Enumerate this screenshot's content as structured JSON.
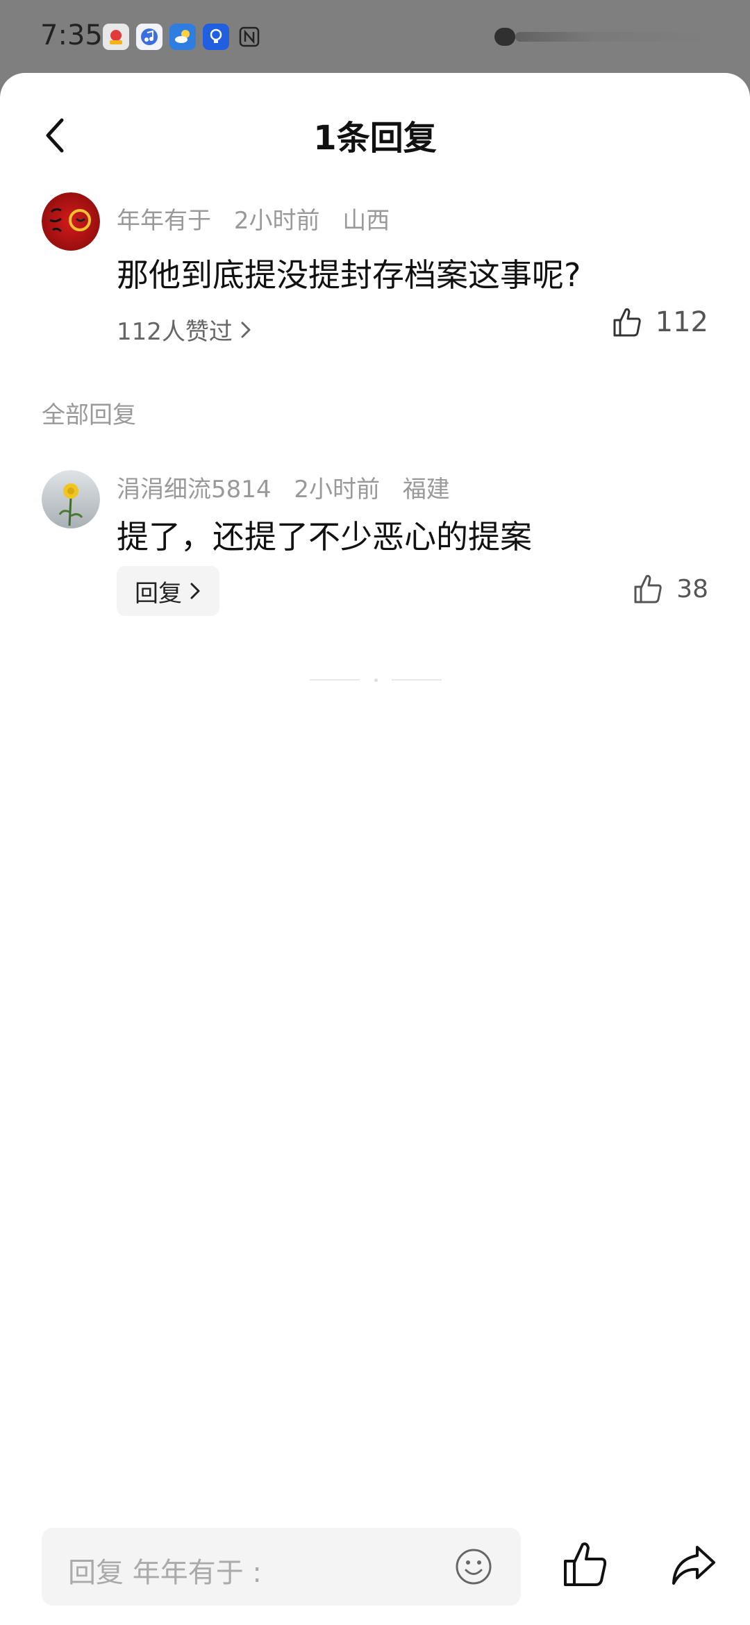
{
  "status_bar": {
    "time": "7:35",
    "icons": [
      "app-notification-icon",
      "music-icon",
      "weather-icon",
      "lightbulb-icon",
      "nfc-icon"
    ]
  },
  "header": {
    "title": "1条回复",
    "back_icon": "chevron-left-icon"
  },
  "main_comment": {
    "username": "年年有于",
    "time": "2小时前",
    "location": "山西",
    "text": "那他到底提没提封存档案这事呢?",
    "likers_text": "112人赞过",
    "like_count": "112",
    "avatar_color": "#b31217"
  },
  "replies_section": {
    "label": "全部回复"
  },
  "replies": [
    {
      "username": "涓涓细流5814",
      "time": "2小时前",
      "location": "福建",
      "text": "提了，还提了不少恶心的提案",
      "reply_button_label": "回复",
      "like_count": "38",
      "avatar_color": "#e9c531"
    }
  ],
  "bottom_bar": {
    "input_placeholder": "回复 年年有于 :",
    "emoji_icon": "smiley-icon",
    "like_icon": "thumbs-up-icon",
    "share_icon": "share-arrow-icon"
  }
}
